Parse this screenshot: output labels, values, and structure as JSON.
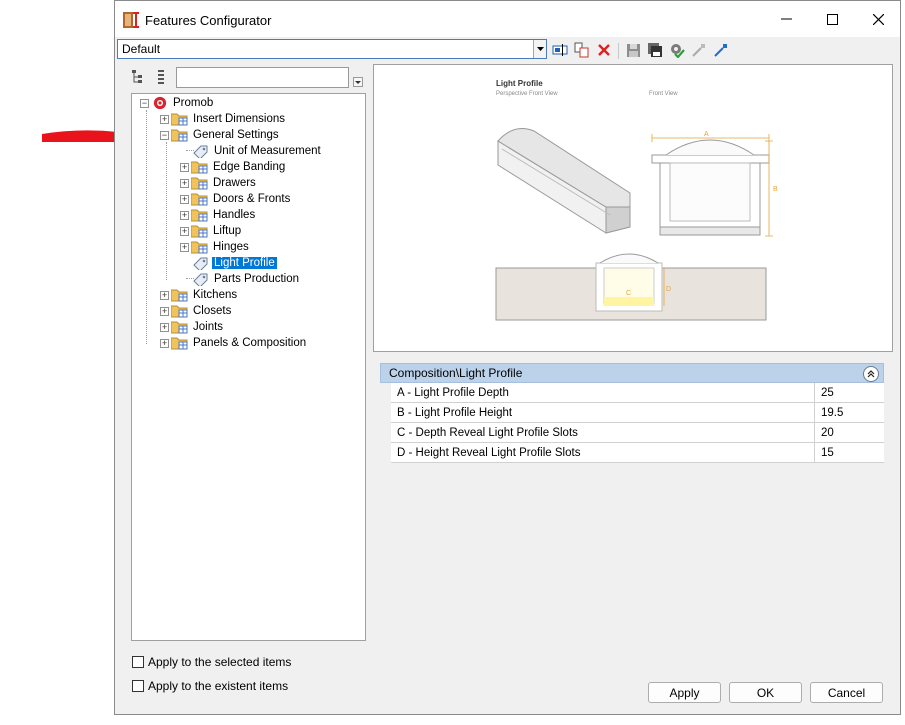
{
  "window": {
    "title": "Features Configurator"
  },
  "toolbar": {
    "configuration_value": "Default"
  },
  "tree": {
    "root": "Promob",
    "items": [
      {
        "label": "Insert Dimensions"
      },
      {
        "label": "General Settings"
      },
      {
        "label": "Unit of Measurement"
      },
      {
        "label": "Edge Banding"
      },
      {
        "label": "Drawers"
      },
      {
        "label": "Doors & Fronts"
      },
      {
        "label": "Handles"
      },
      {
        "label": "Liftup"
      },
      {
        "label": "Hinges"
      },
      {
        "label": "Light Profile"
      },
      {
        "label": "Parts Production"
      },
      {
        "label": "Kitchens"
      },
      {
        "label": "Closets"
      },
      {
        "label": "Joints"
      },
      {
        "label": "Panels & Composition"
      }
    ]
  },
  "preview": {
    "title": "Light Profile",
    "subtitle1": "Perspective Front View",
    "subtitle2": "Front View",
    "dim_a": "A",
    "dim_b": "B",
    "dim_c": "C",
    "dim_d": "D"
  },
  "properties": {
    "header": "Composition\\Light Profile",
    "rows": [
      {
        "name": "A - Light Profile Depth",
        "value": "25"
      },
      {
        "name": "B - Light Profile Height",
        "value": "19.5"
      },
      {
        "name": "C - Depth Reveal Light Profile Slots",
        "value": "20"
      },
      {
        "name": "D - Height Reveal Light Profile Slots",
        "value": "15"
      }
    ]
  },
  "options": {
    "apply_selected": "Apply to the selected items",
    "apply_existent": "Apply to the existent items"
  },
  "buttons": {
    "apply": "Apply",
    "ok": "OK",
    "cancel": "Cancel"
  },
  "colors": {
    "accent": "#0078d7",
    "arrow": "#e8131b",
    "dimension": "#e6a43b",
    "header": "#bcd2ea"
  }
}
